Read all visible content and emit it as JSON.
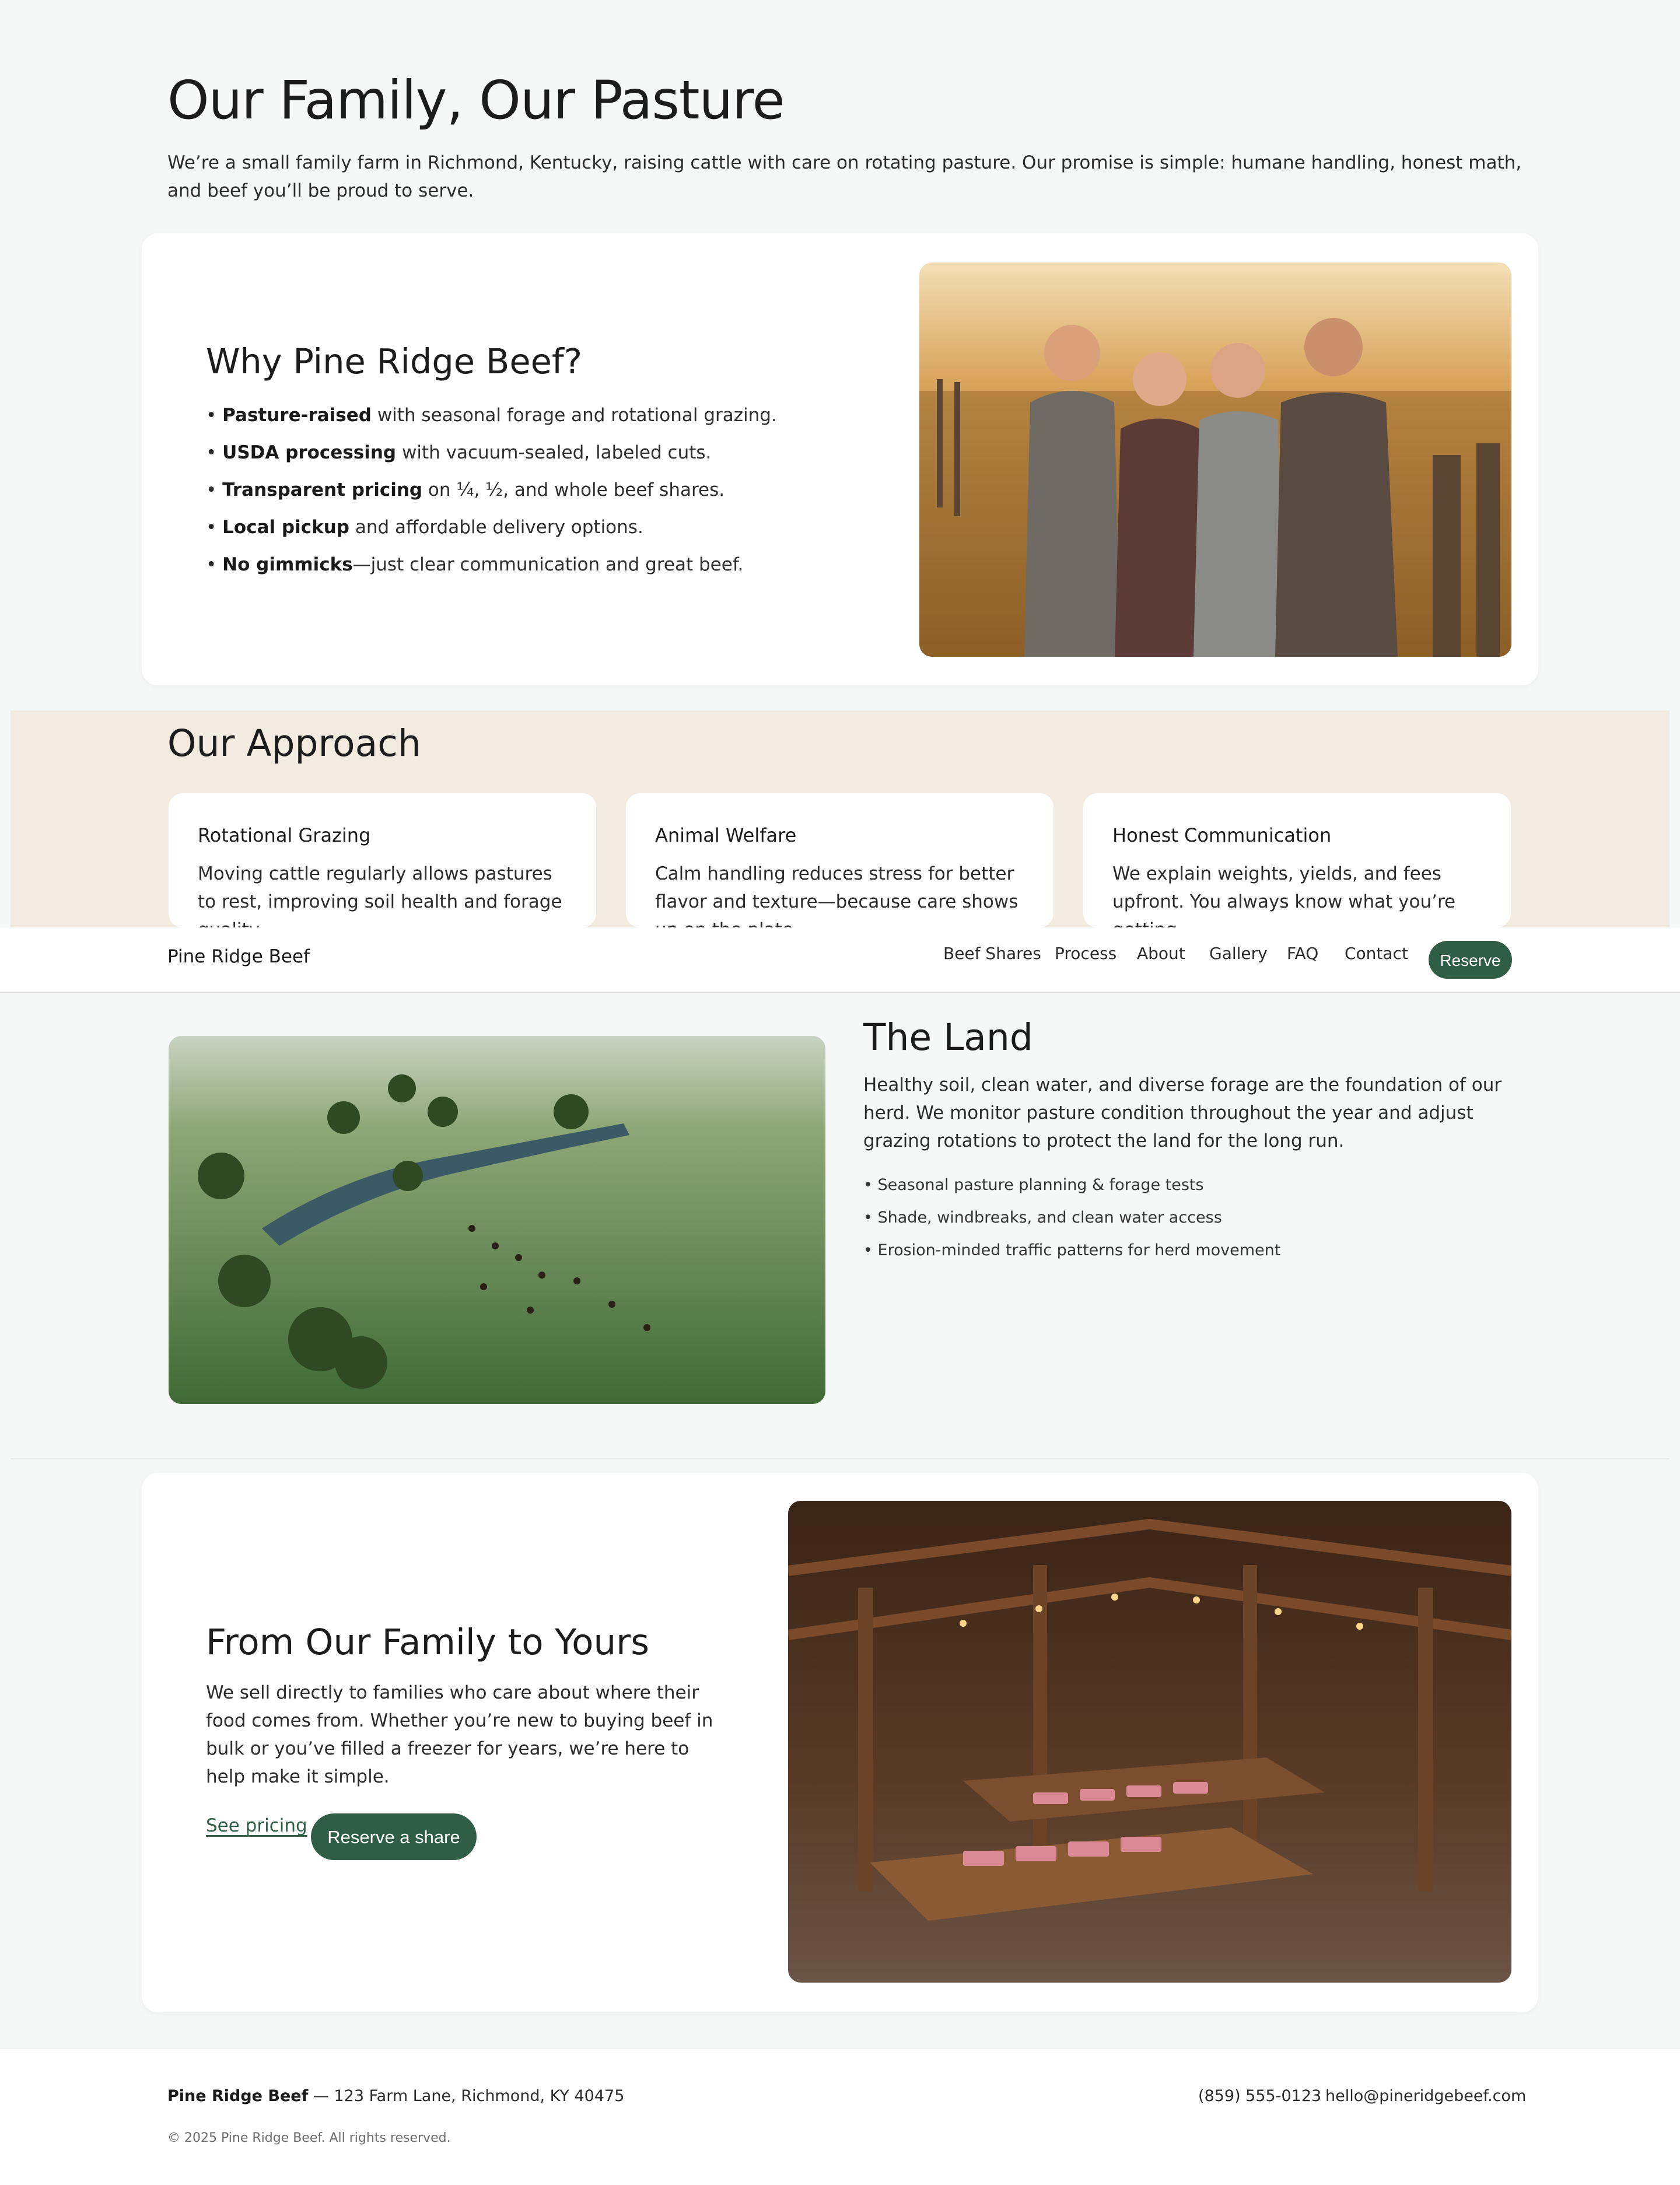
{
  "hero": {
    "title": "Our Family, Our Pasture",
    "intro": "We’re a small family farm in Richmond, Kentucky, raising cattle with care on rotating pasture. Our promise is simple: humane handling, honest math, and beef you’ll be proud to serve."
  },
  "why": {
    "title": "Why Pine Ridge Beef?",
    "items": [
      {
        "bold": "Pasture-raised",
        "text": " with seasonal forage and rotational grazing."
      },
      {
        "bold": "USDA processing",
        "text": " with vacuum-sealed, labeled cuts."
      },
      {
        "bold": "Transparent pricing",
        "text": " on ¼, ½, and whole beef shares."
      },
      {
        "bold": "Local pickup",
        "text": " and affordable delivery options."
      },
      {
        "bold": "No gimmicks",
        "text": "—just clear communication and great beef."
      }
    ]
  },
  "approach": {
    "title": "Our Approach",
    "cards": [
      {
        "title": "Rotational Grazing",
        "text": "Moving cattle regularly allows pastures to rest, improving soil health and forage quality."
      },
      {
        "title": "Animal Welfare",
        "text": "Calm handling reduces stress for better flavor and texture—because care shows up on the plate."
      },
      {
        "title": "Honest Communication",
        "text": "We explain weights, yields, and fees upfront. You always know what you’re getting."
      }
    ]
  },
  "nav": {
    "brand": "Pine Ridge Beef",
    "links": [
      "Beef Shares",
      "Process",
      "About",
      "Gallery",
      "FAQ",
      "Contact"
    ],
    "reserve": "Reserve"
  },
  "land": {
    "title": "The Land",
    "text": "Healthy soil, clean water, and diverse forage are the foundation of our herd. We monitor pasture condition throughout the year and adjust grazing rotations to protect the land for the long run.",
    "items": [
      "• Seasonal pasture planning & forage tests",
      "• Shade, windbreaks, and clean water access",
      "• Erosion-minded traffic patterns for herd movement"
    ]
  },
  "family": {
    "title": "From Our Family to Yours",
    "text": "We sell directly to families who care about where their food comes from. Whether you’re new to buying beef in bulk or you’ve filled a freezer for years, we’re here to help make it simple.",
    "pricing_link": "See pricing",
    "reserve_button": "Reserve a share"
  },
  "footer": {
    "brand": "Pine Ridge Beef",
    "address": " — 123 Farm Lane, Richmond, KY 40475",
    "phone": "(859) 555-0123",
    "email": "hello@pineridgebeef.com",
    "copyright": "© 2025 Pine Ridge Beef. All rights reserved."
  },
  "colors": {
    "accent": "#2f5d45",
    "page_bg": "#f6f8f7",
    "approach_band": "#f2ebdf"
  }
}
